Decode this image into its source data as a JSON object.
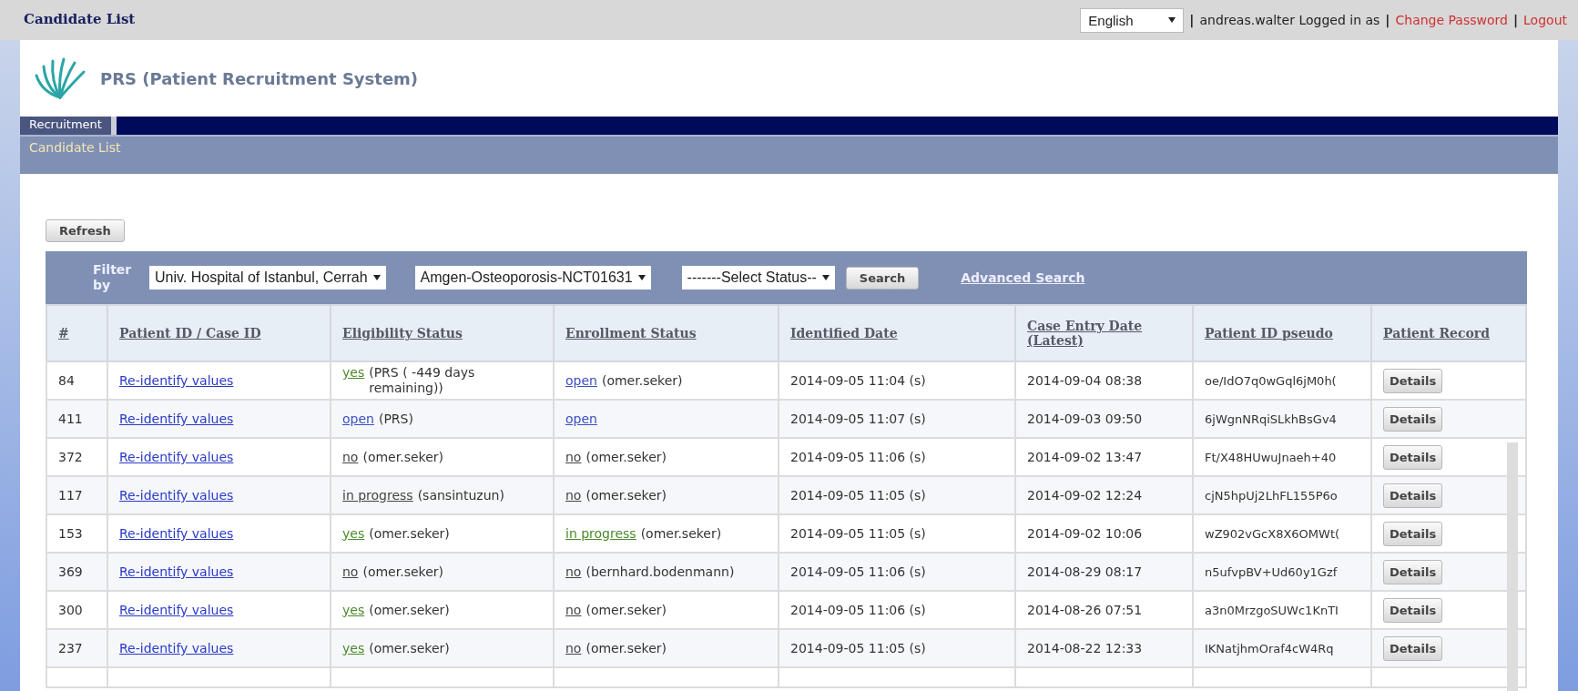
{
  "top_bar": {
    "title": "Candidate List",
    "language": "English",
    "separator_1": "|",
    "user_text": "andreas.walter Logged in as",
    "separator_2": "|",
    "change_password": "Change Password",
    "separator_3": "|",
    "logout": "Logout"
  },
  "app_title": "PRS (Patient Recruitment System)",
  "menu_tabs": [
    {
      "label": "Recruitment",
      "selected": true
    }
  ],
  "breadcrumb": "Candidate List",
  "refresh_button": "Refresh",
  "filter": {
    "label": "Filter by",
    "site": "Univ. Hospital of Istanbul, Cerrah",
    "study": "Amgen-Osteoporosis-NCT01631",
    "status": "-------Select Status--",
    "search_button": "Search",
    "advanced_search": "Advanced Search"
  },
  "table": {
    "columns": [
      "#",
      "Patient ID / Case ID",
      "Eligibility Status",
      "Enrollment Status",
      "Identified Date",
      "Case Entry Date (Latest)",
      "Patient ID pseudo",
      "Patient Record"
    ],
    "rows": [
      {
        "num": "84",
        "patient_link": "Re-identify values",
        "eligibility": {
          "link": "yes",
          "note": "(PRS ( -449 days remaining))",
          "color": "#4a8a2a"
        },
        "enrollment": {
          "link": "open",
          "note": "(omer.seker)",
          "color": "#3b4fc4"
        },
        "identified": "2014-09-05 11:04 (s)",
        "case_entry": "2014-09-04 08:38",
        "pseudo": "oe/IdO7q0wGql6jM0h(",
        "record_button": "Details"
      },
      {
        "num": "411",
        "patient_link": "Re-identify values",
        "eligibility": {
          "link": "open",
          "note": "(PRS)",
          "color": "#3b4fc4"
        },
        "enrollment": {
          "link": "open",
          "color": "#3b4fc4"
        },
        "identified": "2014-09-05 11:07 (s)",
        "case_entry": "2014-09-03 09:50",
        "pseudo": "6jWgnNRqiSLkhBsGv4",
        "record_button": "Details"
      },
      {
        "num": "372",
        "patient_link": "Re-identify values",
        "eligibility": {
          "link": "no",
          "note": "(omer.seker)",
          "color": "#444444"
        },
        "enrollment": {
          "link": "no",
          "note": "(omer.seker)",
          "color": "#444444"
        },
        "identified": "2014-09-05 11:06 (s)",
        "case_entry": "2014-09-02 13:47",
        "pseudo": "Ft/X48HUwuJnaeh+40",
        "record_button": "Details"
      },
      {
        "num": "117",
        "patient_link": "Re-identify values",
        "eligibility": {
          "link": "in progress",
          "note": "(sansintuzun)",
          "color": "#444444"
        },
        "enrollment": {
          "link": "no",
          "note": "(omer.seker)",
          "color": "#444444"
        },
        "identified": "2014-09-05 11:05 (s)",
        "case_entry": "2014-09-02 12:24",
        "pseudo": "cjN5hpUj2LhFL155P6o",
        "record_button": "Details"
      },
      {
        "num": "153",
        "patient_link": "Re-identify values",
        "eligibility": {
          "link": "yes",
          "note": "(omer.seker)",
          "color": "#4a8a2a"
        },
        "enrollment": {
          "link": "in progress",
          "note": "(omer.seker)",
          "color": "#4a8a2a"
        },
        "identified": "2014-09-05 11:05 (s)",
        "case_entry": "2014-09-02 10:06",
        "pseudo": "wZ902vGcX8X6OMWt(",
        "record_button": "Details"
      },
      {
        "num": "369",
        "patient_link": "Re-identify values",
        "eligibility": {
          "link": "no",
          "note": "(omer.seker)",
          "color": "#444444"
        },
        "enrollment": {
          "link": "no",
          "note": "(bernhard.bodenmann)",
          "color": "#444444"
        },
        "identified": "2014-09-05 11:06 (s)",
        "case_entry": "2014-08-29 08:17",
        "pseudo": "n5ufvpBV+Ud60y1Gzf",
        "record_button": "Details"
      },
      {
        "num": "300",
        "patient_link": "Re-identify values",
        "eligibility": {
          "link": "yes",
          "note": "(omer.seker)",
          "color": "#4a8a2a"
        },
        "enrollment": {
          "link": "no",
          "note": "(omer.seker)",
          "color": "#444444"
        },
        "identified": "2014-09-05 11:06 (s)",
        "case_entry": "2014-08-26 07:51",
        "pseudo": "a3n0MrzgoSUWc1KnTI",
        "record_button": "Details"
      },
      {
        "num": "237",
        "patient_link": "Re-identify values",
        "eligibility": {
          "link": "yes",
          "note": "(omer.seker)",
          "color": "#4a8a2a"
        },
        "enrollment": {
          "link": "no",
          "note": "(omer.seker)",
          "color": "#444444"
        },
        "identified": "2014-09-05 11:05 (s)",
        "case_entry": "2014-08-22 12:33",
        "pseudo": "IKNatjhmOraf4cW4Rq",
        "record_button": "Details"
      }
    ]
  }
}
